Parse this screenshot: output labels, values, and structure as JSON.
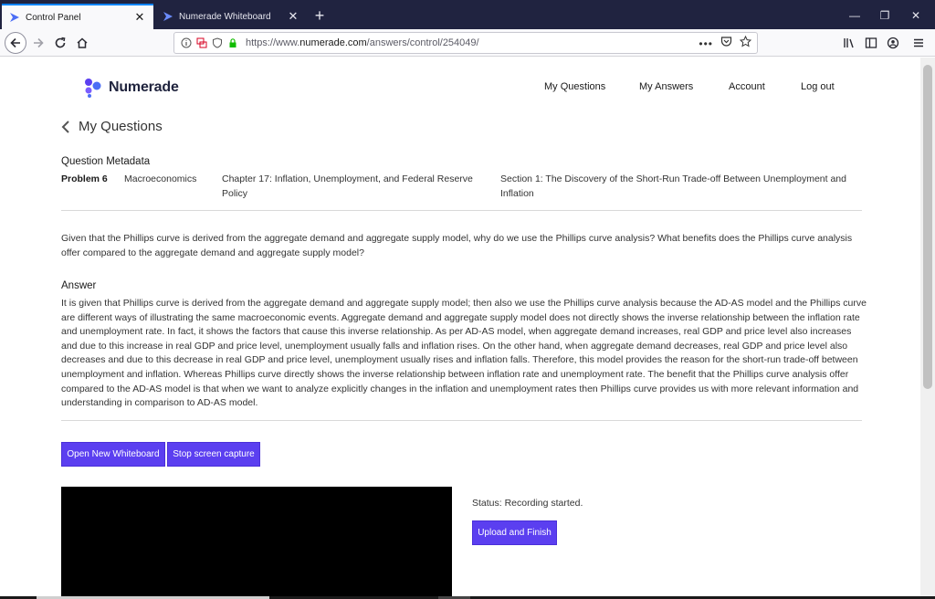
{
  "browser": {
    "tabs": [
      {
        "title": "Control Panel",
        "active": true
      },
      {
        "title": "Numerade Whiteboard",
        "active": false
      }
    ],
    "url_prefix": "https://www.",
    "url_domain": "numerade.com",
    "url_path": "/answers/control/254049/"
  },
  "header": {
    "logo_text": "Numerade",
    "nav": [
      "My Questions",
      "My Answers",
      "Account",
      "Log out"
    ]
  },
  "page_title": "My Questions",
  "metadata": {
    "heading": "Question Metadata",
    "problem": "Problem 6",
    "subject": "Macroeconomics",
    "chapter": "Chapter 17: Inflation, Unemployment, and Federal Reserve Policy",
    "section": "Section 1: The Discovery of the Short-Run Trade-off Between Unemployment and Inflation"
  },
  "question": "Given that the Phillips curve is derived from the aggregate demand and aggregate supply model, why do we use the Phillips curve analysis? What benefits does the Phillips curve analysis offer compared to the aggregate demand and aggregate supply model?",
  "answer": {
    "heading": "Answer",
    "text": "It is given that Phillips curve is derived from the aggregate demand and aggregate supply model; then also we use the Phillips curve analysis because the AD-AS model and the Phillips curve are different ways of illustrating the same macroeconomic events. Aggregate demand and aggregate supply model does not directly shows the inverse relationship between the inflation rate and unemployment rate. In fact, it shows the factors that cause this inverse relationship. As per AD-AS model, when aggregate demand increases, real GDP and price level also increases and due to this increase in real GDP and price level, unemployment usually falls and inflation rises. On the other hand, when aggregate demand decreases, real GDP and price level also decreases and due to this decrease in real GDP and price level, unemployment usually rises and inflation falls. Therefore, this model provides the reason for the short-run trade-off between unemployment and inflation. Whereas Phillips curve directly shows the inverse relationship between inflation rate and unemployment rate. The benefit that the Phillips curve analysis offer compared to the AD-AS model is that when we want to analyze explicitly changes in the inflation and unemployment rates then Phillips curve provides us with more relevant information and understanding in comparison to AD-AS model."
  },
  "actions": {
    "open_whiteboard": "Open New Whiteboard",
    "stop_capture": "Stop screen capture",
    "status": "Status: Recording started.",
    "upload": "Upload and Finish"
  },
  "colors": {
    "accent": "#5b3ff0",
    "tabbar": "#202340",
    "brand_blue": "#4c6ef5"
  }
}
